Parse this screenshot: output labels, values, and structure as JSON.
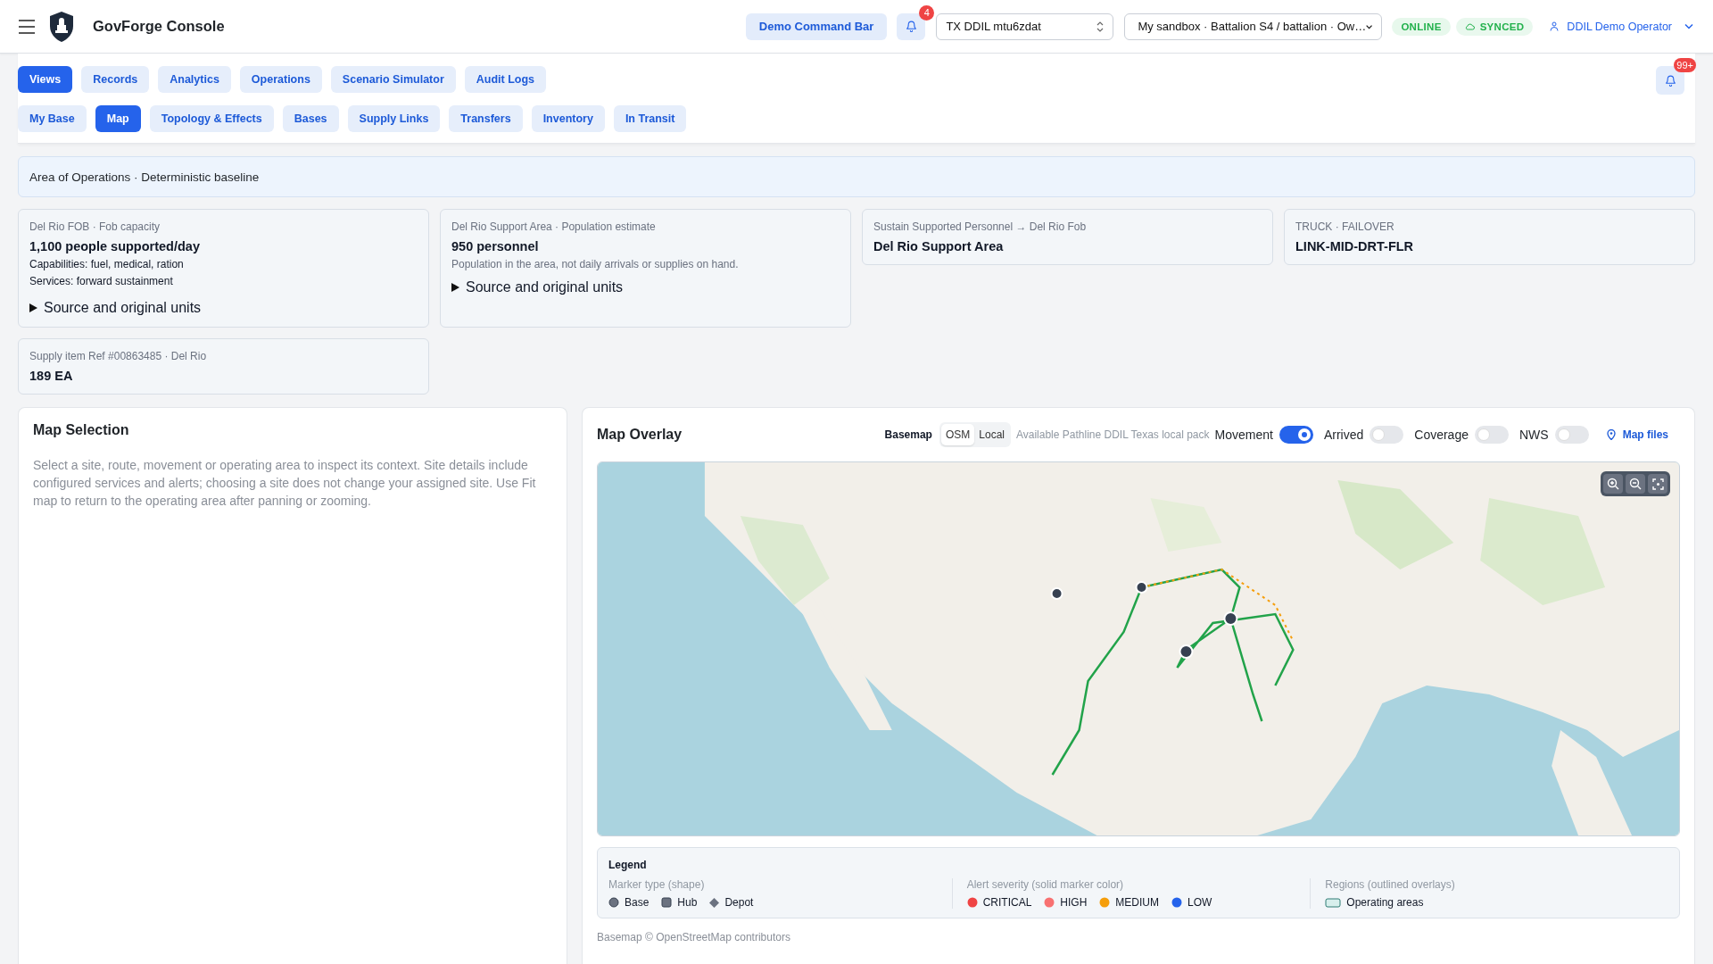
{
  "header": {
    "title": "GovForge Console",
    "command_button": "Demo Command Bar",
    "notification_count": "4",
    "tenant_select": "TX DDIL mtu6zdat",
    "scope_select": "My sandbox · Battalion S4 / battalion · Ow…",
    "statuses": [
      {
        "label": "ONLINE",
        "kind": "online"
      },
      {
        "label": "SYNCED",
        "kind": "synced"
      }
    ],
    "user": "DDIL Demo Operator"
  },
  "primary_tabs": [
    {
      "label": "Views",
      "selected": true
    },
    {
      "label": "Records",
      "selected": false
    },
    {
      "label": "Analytics",
      "selected": false
    },
    {
      "label": "Operations",
      "selected": false
    },
    {
      "label": "Scenario Simulator",
      "selected": false
    },
    {
      "label": "Audit Logs",
      "selected": false
    }
  ],
  "secondary_tabs": [
    {
      "label": "My Base",
      "selected": false
    },
    {
      "label": "Map",
      "selected": true
    },
    {
      "label": "Topology & Effects",
      "selected": false
    },
    {
      "label": "Bases",
      "selected": false
    },
    {
      "label": "Supply Links",
      "selected": false
    },
    {
      "label": "Transfers",
      "selected": false
    },
    {
      "label": "Inventory",
      "selected": false
    },
    {
      "label": "In Transit",
      "selected": false
    }
  ],
  "alerts_badge": "99+",
  "banner": "Area of Operations · Deterministic baseline",
  "cards": [
    {
      "eyebrow": "Del Rio FOB · Fob capacity",
      "value": "1,100 people supported/day",
      "lines": [
        "Capabilities: fuel, medical, ration",
        "Services: forward sustainment"
      ],
      "details": {
        "label": "Source and original units",
        "expanded": false
      }
    },
    {
      "eyebrow": "Del Rio Support Area · Population estimate",
      "value": "950 personnel",
      "note": "Population in the area, not daily arrivals or supplies on hand.",
      "details": {
        "label": "Source and original units",
        "expanded": false
      }
    },
    {
      "eyebrow": "Sustain Supported Personnel → Del Rio Fob",
      "value": "Del Rio Support Area"
    },
    {
      "eyebrow": "TRUCK · FAILOVER",
      "value": "LINK-MID-DRT-FLR"
    },
    {
      "eyebrow": "Supply item Ref #00863485 · Del Rio",
      "value": "189 EA"
    }
  ],
  "map_selection": {
    "title": "Map Selection",
    "text": "Select a site, route, movement or operating area to inspect its context. Site details include configured services and alerts; choosing a site does not change your assigned site. Use Fit map to return to the operating area after panning or zooming."
  },
  "map_overlay": {
    "title": "Map Overlay",
    "basemap_label": "Basemap",
    "basemap_options": [
      {
        "label": "OSM",
        "selected": true
      },
      {
        "label": "Local",
        "selected": false
      }
    ],
    "availability": "Available Pathline DDIL Texas local pack",
    "toggles": [
      {
        "label": "Movement",
        "on": true
      },
      {
        "label": "Arrived",
        "on": false
      },
      {
        "label": "Coverage",
        "on": false
      },
      {
        "label": "NWS",
        "on": false
      }
    ],
    "map_files": "Map files",
    "legend": {
      "title": "Legend",
      "groups": [
        {
          "title": "Marker type (shape)",
          "items": [
            {
              "label": "Base",
              "kind": "circle"
            },
            {
              "label": "Hub",
              "kind": "square"
            },
            {
              "label": "Depot",
              "kind": "diamond"
            }
          ]
        },
        {
          "title": "Alert severity (solid marker color)",
          "items": [
            {
              "label": "CRITICAL",
              "kind": "dot",
              "color": "#ef4444"
            },
            {
              "label": "HIGH",
              "kind": "dot",
              "color": "#f87171"
            },
            {
              "label": "MEDIUM",
              "kind": "dot",
              "color": "#f59e0b"
            },
            {
              "label": "LOW",
              "kind": "dot",
              "color": "#2563eb"
            }
          ]
        },
        {
          "title": "Regions (outlined overlays)",
          "items": [
            {
              "label": "Operating areas",
              "kind": "outline"
            }
          ]
        }
      ]
    },
    "attribution": "Basemap © OpenStreetMap contributors"
  }
}
